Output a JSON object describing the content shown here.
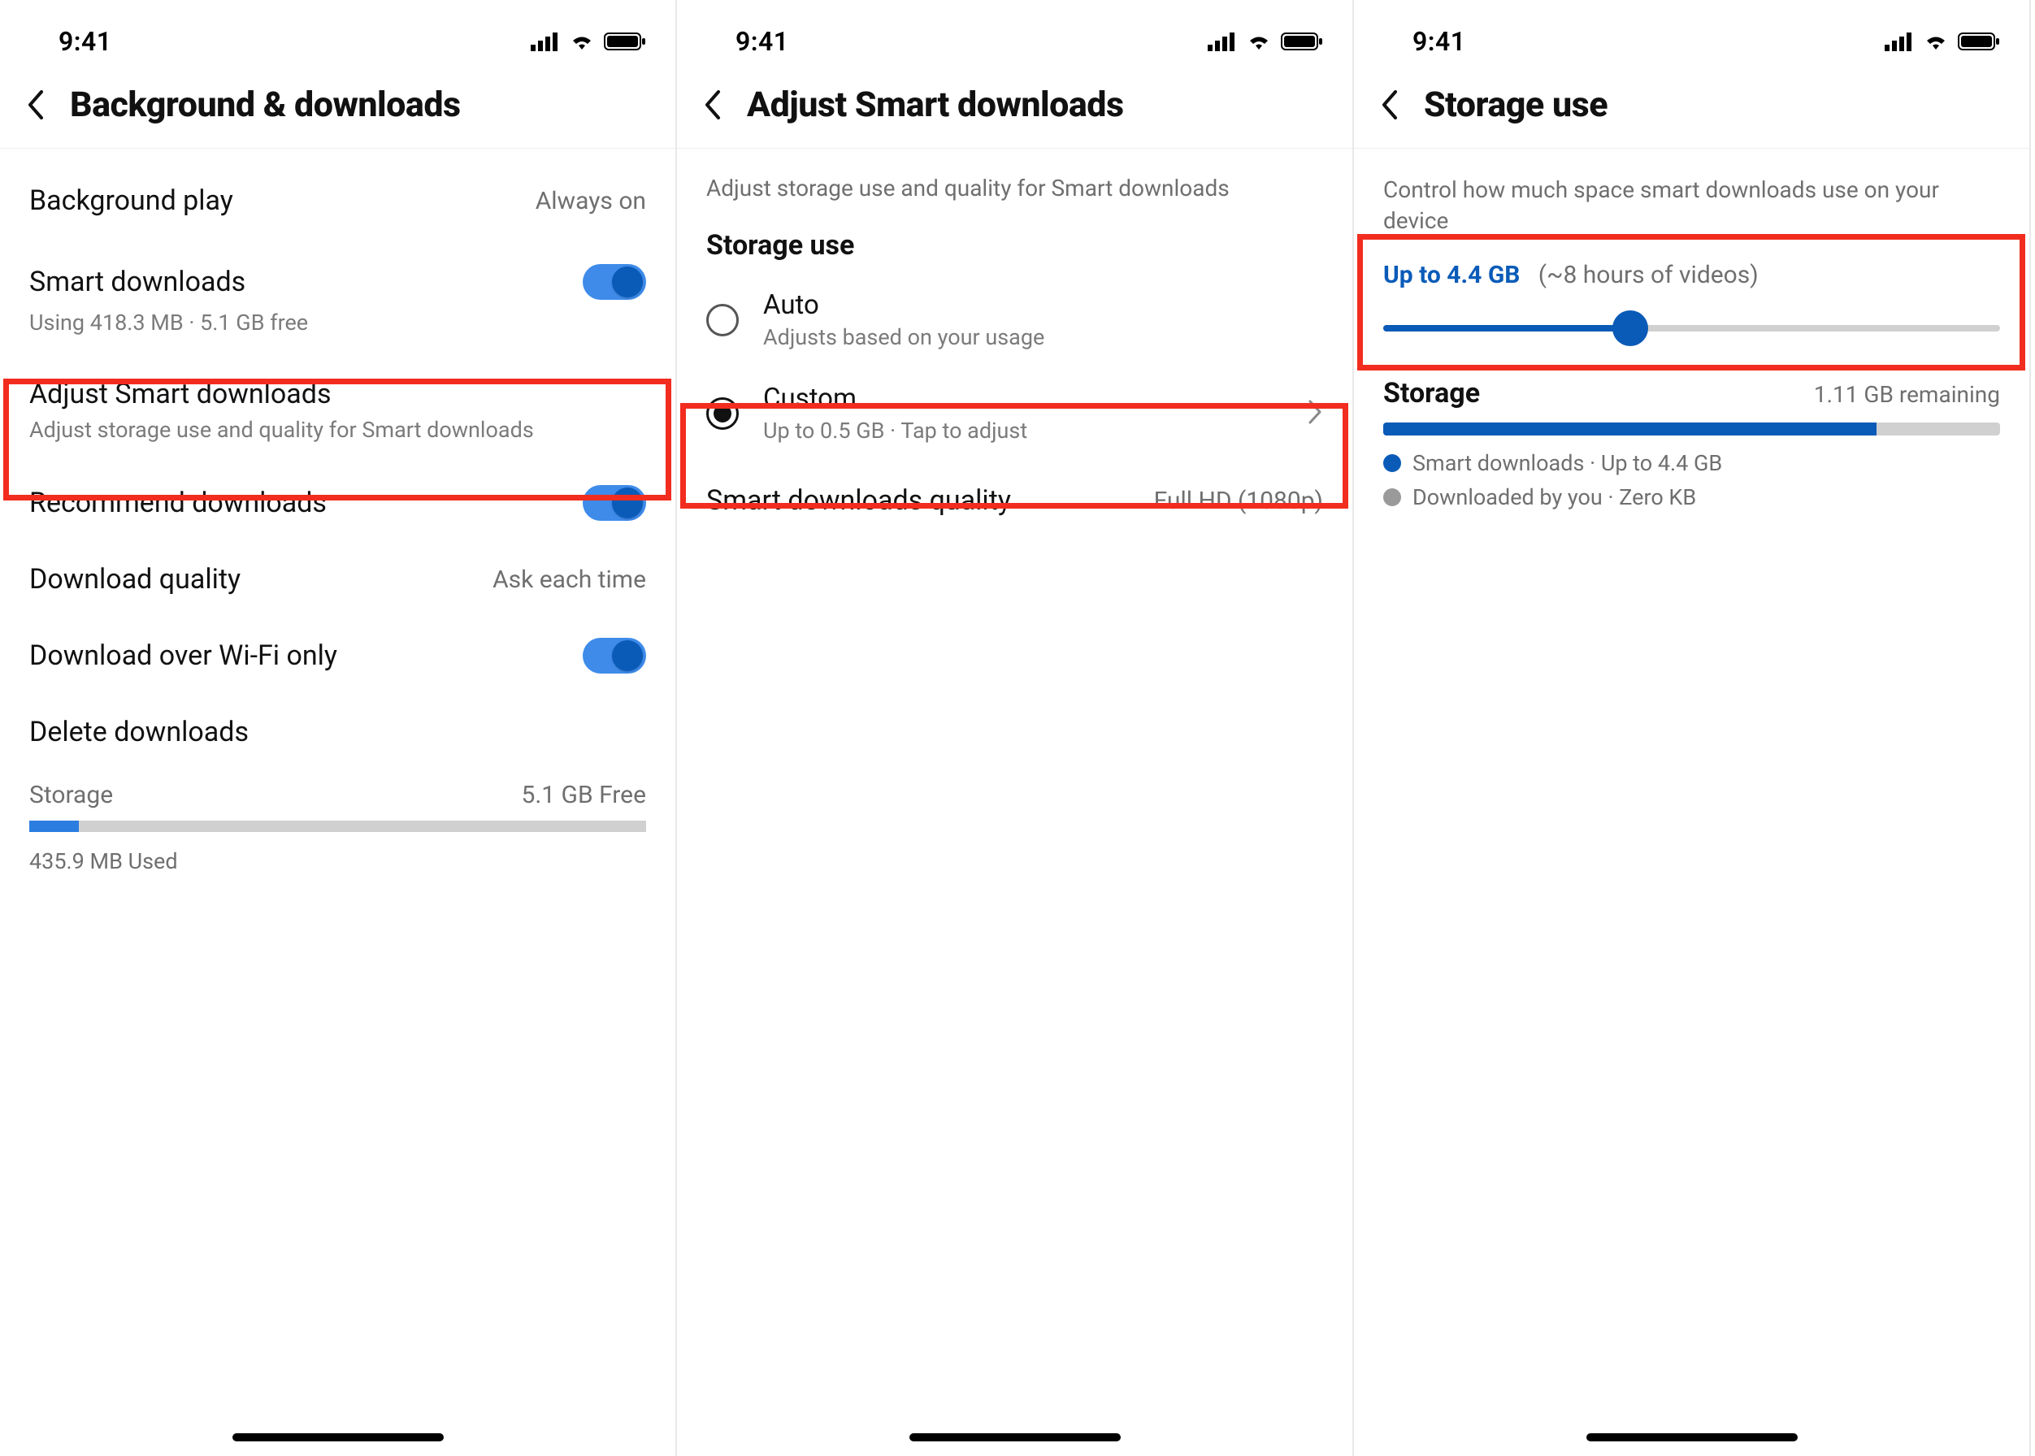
{
  "statusbar": {
    "time": "9:41"
  },
  "screen1": {
    "title": "Background & downloads",
    "rows": {
      "background_play": {
        "label": "Background play",
        "value": "Always on"
      },
      "smart_downloads": {
        "label": "Smart downloads",
        "sub": "Using 418.3 MB · 5.1 GB free"
      },
      "adjust": {
        "label": "Adjust Smart downloads",
        "sub": "Adjust storage use and quality for Smart downloads"
      },
      "recommend": {
        "label": "Recommend downloads"
      },
      "quality": {
        "label": "Download quality",
        "value": "Ask each time"
      },
      "wifi_only": {
        "label": "Download over Wi-Fi only"
      },
      "delete": {
        "label": "Delete downloads"
      }
    },
    "storage": {
      "label": "Storage",
      "free": "5.1 GB Free",
      "used": "435.9 MB Used",
      "fill_percent": 8
    }
  },
  "screen2": {
    "title": "Adjust Smart downloads",
    "desc": "Adjust storage use and quality for Smart downloads",
    "section": "Storage use",
    "auto": {
      "label": "Auto",
      "sub": "Adjusts based on your usage"
    },
    "custom": {
      "label": "Custom",
      "sub": "Up to 0.5 GB · Tap to adjust"
    },
    "quality_row": {
      "label": "Smart downloads quality",
      "value": "Full HD (1080p)"
    }
  },
  "screen3": {
    "title": "Storage use",
    "desc": "Control how much space smart downloads use on your device",
    "slider": {
      "main": "Up to 4.4 GB",
      "sub": "(~8 hours of videos)",
      "percent": 40
    },
    "storage": {
      "label": "Storage",
      "remaining": "1.11 GB remaining",
      "seg1_percent": 80,
      "legend1": "Smart downloads · Up to 4.4 GB",
      "legend2": "Downloaded by you · Zero KB"
    }
  }
}
